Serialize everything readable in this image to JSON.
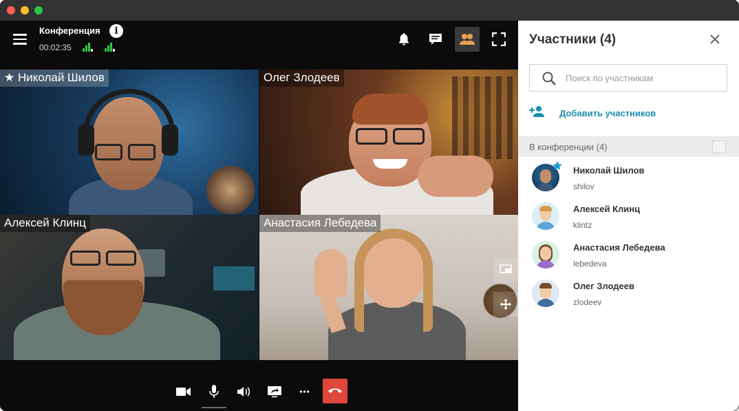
{
  "window": {
    "traffic_lights": [
      "close",
      "minimize",
      "maximize"
    ]
  },
  "topbar": {
    "title": "Конференция",
    "info_icon_glyph": "i",
    "timer": "00:02:35",
    "buttons": [
      "bell-icon",
      "chat-icon",
      "participants-icon",
      "fullscreen-icon"
    ],
    "active_button": "participants-icon",
    "accent_color": "#f0a050"
  },
  "tiles": [
    {
      "name": "Николай Шилов",
      "pinned": true,
      "star_glyph": "★"
    },
    {
      "name": "Олег Злодеев",
      "pinned": false
    },
    {
      "name": "Алексей Клинц",
      "pinned": false
    },
    {
      "name": "Анастасия Лебедева",
      "pinned": false
    }
  ],
  "bottombar": {
    "buttons": [
      "camera-icon",
      "microphone-icon",
      "speaker-icon",
      "screen-share-icon",
      "more-icon",
      "hangup-icon"
    ],
    "more_glyph": "•••",
    "hangup_color": "#e0463b"
  },
  "panel": {
    "title": "Участники (4)",
    "search_placeholder": "Поиск по участникам",
    "add_label": "Добавить участников",
    "section_label": "В конференции (4)",
    "link_color": "#1a8fb0",
    "participants": [
      {
        "name": "Николай Шилов",
        "login": "shilov",
        "is_host": true
      },
      {
        "name": "Алексей Клинц",
        "login": "klintz",
        "is_host": false
      },
      {
        "name": "Анастасия Лебедева",
        "login": "lebedeva",
        "is_host": false
      },
      {
        "name": "Олег Злодеев",
        "login": "zlodeev",
        "is_host": false
      }
    ]
  }
}
